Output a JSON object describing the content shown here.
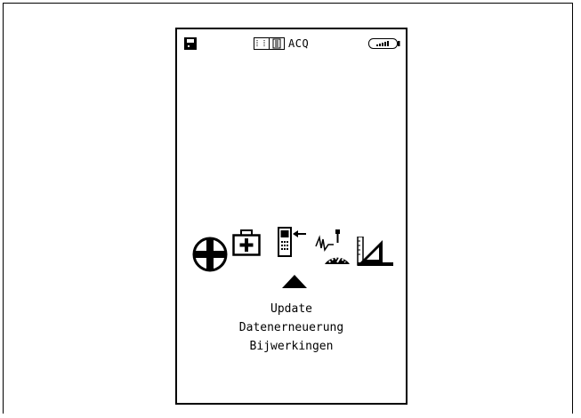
{
  "status_bar": {
    "mode_label": "ACQ",
    "icons": [
      "save-icon",
      "memory-icon",
      "battery-icon"
    ]
  },
  "menu": {
    "icons": [
      "crosshair-icon",
      "first-aid-icon",
      "transfer-icon",
      "calibration-gauge-icon",
      "set-square-icon"
    ],
    "selected_index": 0,
    "selector": "up-triangle-icon"
  },
  "selected_item": {
    "label_en": "Update",
    "label_de": "Datenerneuerung",
    "label_nl": "Bijwerkingen"
  }
}
